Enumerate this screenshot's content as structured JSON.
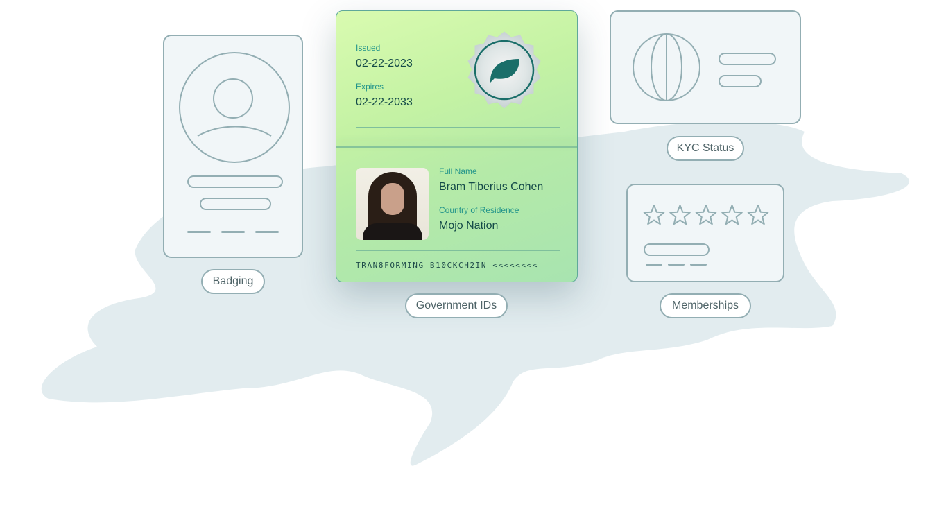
{
  "labels": {
    "badging": "Badging",
    "government_ids": "Government IDs",
    "kyc_status": "KYC Status",
    "memberships": "Memberships"
  },
  "id_card": {
    "issued_label": "Issued",
    "issued": "02-22-2023",
    "expires_label": "Expires",
    "expires": "02-22-2033",
    "full_name_label": "Full Name",
    "full_name": "Bram Tiberius Cohen",
    "country_label": "Country of Residence",
    "country": "Mojo Nation",
    "mrz": "TRAN8FORMING B10CKCH2IN <<<<<<<<"
  },
  "memberships": {
    "stars": 5
  },
  "colors": {
    "outline": "#93aeb3",
    "blob": "#e2ecef",
    "accent": "#1a6e69"
  }
}
